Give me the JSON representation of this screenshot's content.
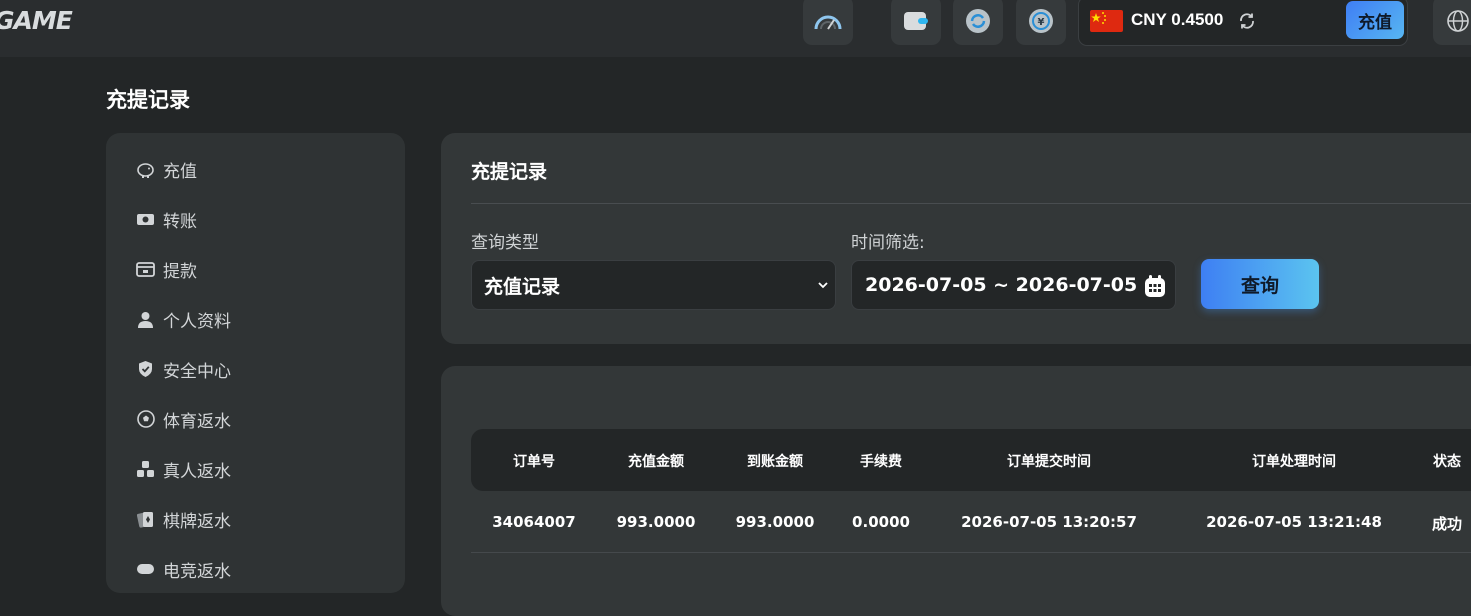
{
  "header": {
    "logo": "GAME",
    "currency_text": "CNY 0.4500",
    "recharge_label": "充值"
  },
  "page": {
    "title": "充提记录"
  },
  "sidebar": {
    "items": [
      {
        "label": "充值",
        "icon": "piggy-bank-icon"
      },
      {
        "label": "转账",
        "icon": "money-transfer-icon"
      },
      {
        "label": "提款",
        "icon": "withdraw-icon"
      },
      {
        "label": "个人资料",
        "icon": "user-icon"
      },
      {
        "label": "安全中心",
        "icon": "shield-icon"
      },
      {
        "label": "体育返水",
        "icon": "soccer-ball-icon"
      },
      {
        "label": "真人返水",
        "icon": "dice-icon"
      },
      {
        "label": "棋牌返水",
        "icon": "cards-icon"
      },
      {
        "label": "电竞返水",
        "icon": "gamepad-icon"
      }
    ]
  },
  "filter": {
    "title": "充提记录",
    "query_type_label": "查询类型",
    "query_type_value": "充值记录",
    "time_label": "时间筛选:",
    "date_range": "2026-07-05 ~ 2026-07-05",
    "query_button": "查询"
  },
  "table": {
    "headers": [
      "订单号",
      "充值金额",
      "到账金额",
      "手续费",
      "订单提交时间",
      "订单处理时间",
      "状态"
    ],
    "rows": [
      [
        "34064007",
        "993.0000",
        "993.0000",
        "0.0000",
        "2026-07-05 13:20:57",
        "2026-07-05 13:21:48",
        "成功"
      ]
    ]
  },
  "colors": {
    "accent_start": "#3f7ef4",
    "accent_end": "#5bc4f0",
    "background": "#232627",
    "panel": "#333738"
  }
}
